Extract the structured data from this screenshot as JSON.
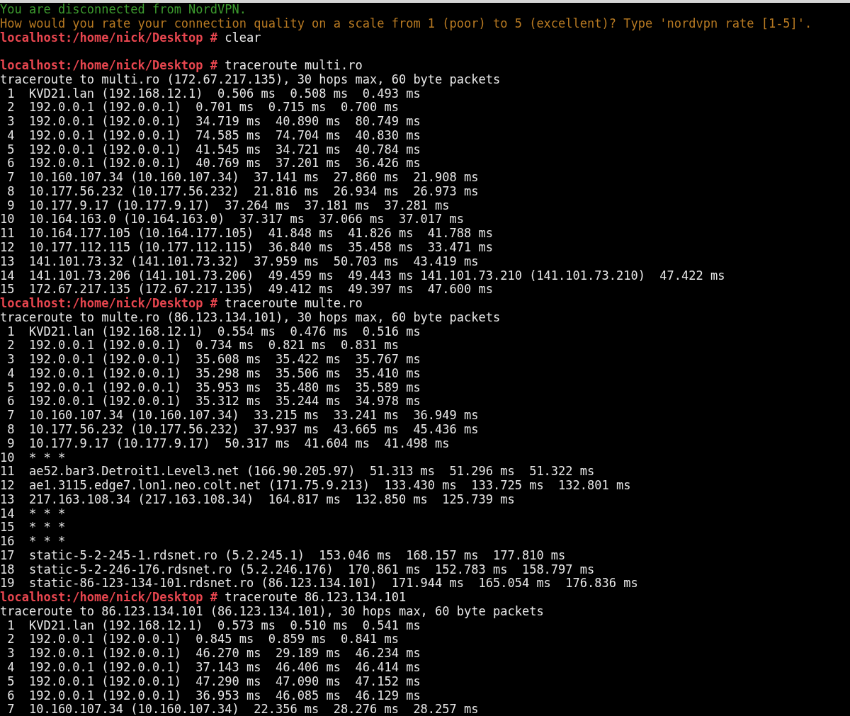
{
  "terminal": {
    "lines": [
      {
        "kind": "notice",
        "text": "You are disconnected from NordVPN."
      },
      {
        "kind": "warning",
        "text": "How would you rate your connection quality on a scale from 1 (poor) to 5 (excellent)? Type 'nordvpn rate [1-5]'."
      },
      {
        "kind": "prompt",
        "prompt": "localhost:/home/nick/Desktop #",
        "command": "clear"
      },
      {
        "kind": "blank"
      },
      {
        "kind": "prompt",
        "prompt": "localhost:/home/nick/Desktop #",
        "command": "traceroute multi.ro"
      },
      {
        "kind": "output",
        "text": "traceroute to multi.ro (172.67.217.135), 30 hops max, 60 byte packets"
      },
      {
        "kind": "output",
        "text": " 1  KVD21.lan (192.168.12.1)  0.506 ms  0.508 ms  0.493 ms"
      },
      {
        "kind": "output",
        "text": " 2  192.0.0.1 (192.0.0.1)  0.701 ms  0.715 ms  0.700 ms"
      },
      {
        "kind": "output",
        "text": " 3  192.0.0.1 (192.0.0.1)  34.719 ms  40.890 ms  80.749 ms"
      },
      {
        "kind": "output",
        "text": " 4  192.0.0.1 (192.0.0.1)  74.585 ms  74.704 ms  40.830 ms"
      },
      {
        "kind": "output",
        "text": " 5  192.0.0.1 (192.0.0.1)  41.545 ms  34.721 ms  40.784 ms"
      },
      {
        "kind": "output",
        "text": " 6  192.0.0.1 (192.0.0.1)  40.769 ms  37.201 ms  36.426 ms"
      },
      {
        "kind": "output",
        "text": " 7  10.160.107.34 (10.160.107.34)  37.141 ms  27.860 ms  21.908 ms"
      },
      {
        "kind": "output",
        "text": " 8  10.177.56.232 (10.177.56.232)  21.816 ms  26.934 ms  26.973 ms"
      },
      {
        "kind": "output",
        "text": " 9  10.177.9.17 (10.177.9.17)  37.264 ms  37.181 ms  37.281 ms"
      },
      {
        "kind": "output",
        "text": "10  10.164.163.0 (10.164.163.0)  37.317 ms  37.066 ms  37.017 ms"
      },
      {
        "kind": "output",
        "text": "11  10.164.177.105 (10.164.177.105)  41.848 ms  41.826 ms  41.788 ms"
      },
      {
        "kind": "output",
        "text": "12  10.177.112.115 (10.177.112.115)  36.840 ms  35.458 ms  33.471 ms"
      },
      {
        "kind": "output",
        "text": "13  141.101.73.32 (141.101.73.32)  37.959 ms  50.703 ms  43.419 ms"
      },
      {
        "kind": "output",
        "text": "14  141.101.73.206 (141.101.73.206)  49.459 ms  49.443 ms 141.101.73.210 (141.101.73.210)  47.422 ms"
      },
      {
        "kind": "output",
        "text": "15  172.67.217.135 (172.67.217.135)  49.412 ms  49.397 ms  47.600 ms"
      },
      {
        "kind": "prompt",
        "prompt": "localhost:/home/nick/Desktop #",
        "command": "traceroute multe.ro"
      },
      {
        "kind": "output",
        "text": "traceroute to multe.ro (86.123.134.101), 30 hops max, 60 byte packets"
      },
      {
        "kind": "output",
        "text": " 1  KVD21.lan (192.168.12.1)  0.554 ms  0.476 ms  0.516 ms"
      },
      {
        "kind": "output",
        "text": " 2  192.0.0.1 (192.0.0.1)  0.734 ms  0.821 ms  0.831 ms"
      },
      {
        "kind": "output",
        "text": " 3  192.0.0.1 (192.0.0.1)  35.608 ms  35.422 ms  35.767 ms"
      },
      {
        "kind": "output",
        "text": " 4  192.0.0.1 (192.0.0.1)  35.298 ms  35.506 ms  35.410 ms"
      },
      {
        "kind": "output",
        "text": " 5  192.0.0.1 (192.0.0.1)  35.953 ms  35.480 ms  35.589 ms"
      },
      {
        "kind": "output",
        "text": " 6  192.0.0.1 (192.0.0.1)  35.312 ms  35.244 ms  34.978 ms"
      },
      {
        "kind": "output",
        "text": " 7  10.160.107.34 (10.160.107.34)  33.215 ms  33.241 ms  36.949 ms"
      },
      {
        "kind": "output",
        "text": " 8  10.177.56.232 (10.177.56.232)  37.937 ms  43.665 ms  45.436 ms"
      },
      {
        "kind": "output",
        "text": " 9  10.177.9.17 (10.177.9.17)  50.317 ms  41.604 ms  41.498 ms"
      },
      {
        "kind": "output",
        "text": "10  * * *"
      },
      {
        "kind": "output",
        "text": "11  ae52.bar3.Detroit1.Level3.net (166.90.205.97)  51.313 ms  51.296 ms  51.322 ms"
      },
      {
        "kind": "output",
        "text": "12  ae1.3115.edge7.lon1.neo.colt.net (171.75.9.213)  133.430 ms  133.725 ms  132.801 ms"
      },
      {
        "kind": "output",
        "text": "13  217.163.108.34 (217.163.108.34)  164.817 ms  132.850 ms  125.739 ms"
      },
      {
        "kind": "output",
        "text": "14  * * *"
      },
      {
        "kind": "output",
        "text": "15  * * *"
      },
      {
        "kind": "output",
        "text": "16  * * *"
      },
      {
        "kind": "output",
        "text": "17  static-5-2-245-1.rdsnet.ro (5.2.245.1)  153.046 ms  168.157 ms  177.810 ms"
      },
      {
        "kind": "output",
        "text": "18  static-5-2-246-176.rdsnet.ro (5.2.246.176)  170.861 ms  152.783 ms  158.797 ms"
      },
      {
        "kind": "output",
        "text": "19  static-86-123-134-101.rdsnet.ro (86.123.134.101)  171.944 ms  165.054 ms  176.836 ms"
      },
      {
        "kind": "prompt",
        "prompt": "localhost:/home/nick/Desktop #",
        "command": "traceroute 86.123.134.101"
      },
      {
        "kind": "output",
        "text": "traceroute to 86.123.134.101 (86.123.134.101), 30 hops max, 60 byte packets"
      },
      {
        "kind": "output",
        "text": " 1  KVD21.lan (192.168.12.1)  0.573 ms  0.510 ms  0.541 ms"
      },
      {
        "kind": "output",
        "text": " 2  192.0.0.1 (192.0.0.1)  0.845 ms  0.859 ms  0.841 ms"
      },
      {
        "kind": "output",
        "text": " 3  192.0.0.1 (192.0.0.1)  46.270 ms  29.189 ms  46.234 ms"
      },
      {
        "kind": "output",
        "text": " 4  192.0.0.1 (192.0.0.1)  37.143 ms  46.406 ms  46.414 ms"
      },
      {
        "kind": "output",
        "text": " 5  192.0.0.1 (192.0.0.1)  47.290 ms  47.090 ms  47.152 ms"
      },
      {
        "kind": "output",
        "text": " 6  192.0.0.1 (192.0.0.1)  36.953 ms  46.085 ms  46.129 ms"
      },
      {
        "kind": "output",
        "text": " 7  10.160.107.34 (10.160.107.34)  22.356 ms  28.276 ms  28.257 ms"
      }
    ]
  }
}
